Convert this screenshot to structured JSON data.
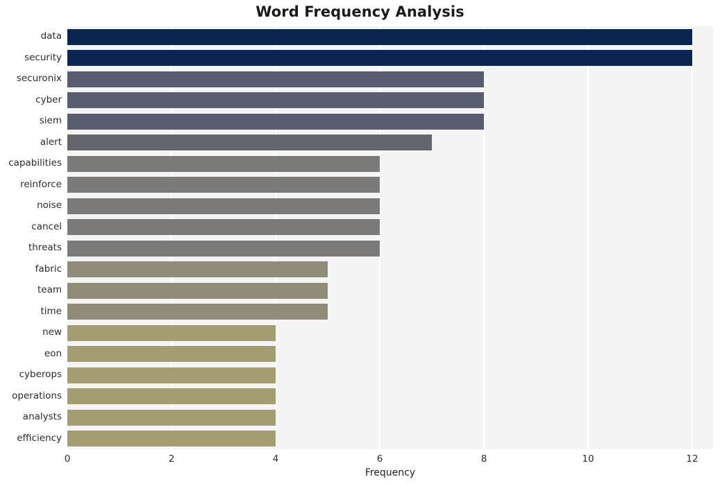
{
  "chart_data": {
    "type": "bar",
    "orientation": "horizontal",
    "title": "Word Frequency Analysis",
    "xlabel": "Frequency",
    "ylabel": "",
    "xlim": [
      0,
      12.4
    ],
    "xticks": [
      0,
      2,
      4,
      6,
      8,
      10,
      12
    ],
    "xtick_labels": [
      "0",
      "2",
      "4",
      "6",
      "8",
      "10",
      "12"
    ],
    "grid": "vertical-only",
    "legend": "none",
    "background": "#f4f4f5",
    "gridline_color": "#ffffff",
    "categories": [
      "data",
      "security",
      "securonix",
      "cyber",
      "siem",
      "alert",
      "capabilities",
      "reinforce",
      "noise",
      "cancel",
      "threats",
      "fabric",
      "team",
      "time",
      "new",
      "eon",
      "cyberops",
      "operations",
      "analysts",
      "efficiency"
    ],
    "values": [
      12,
      12,
      8,
      8,
      8,
      7,
      6,
      6,
      6,
      6,
      6,
      5,
      5,
      5,
      4,
      4,
      4,
      4,
      4,
      4
    ],
    "bar_colors": [
      "#0a2550",
      "#0a2550",
      "#585d71",
      "#585d71",
      "#585d71",
      "#64666e",
      "#7b7a78",
      "#7b7a78",
      "#7b7a78",
      "#7b7a78",
      "#7b7a78",
      "#918b79",
      "#918b79",
      "#918b79",
      "#a59d72",
      "#a59d72",
      "#a59d72",
      "#a59d72",
      "#a59d72",
      "#a59d72"
    ]
  }
}
